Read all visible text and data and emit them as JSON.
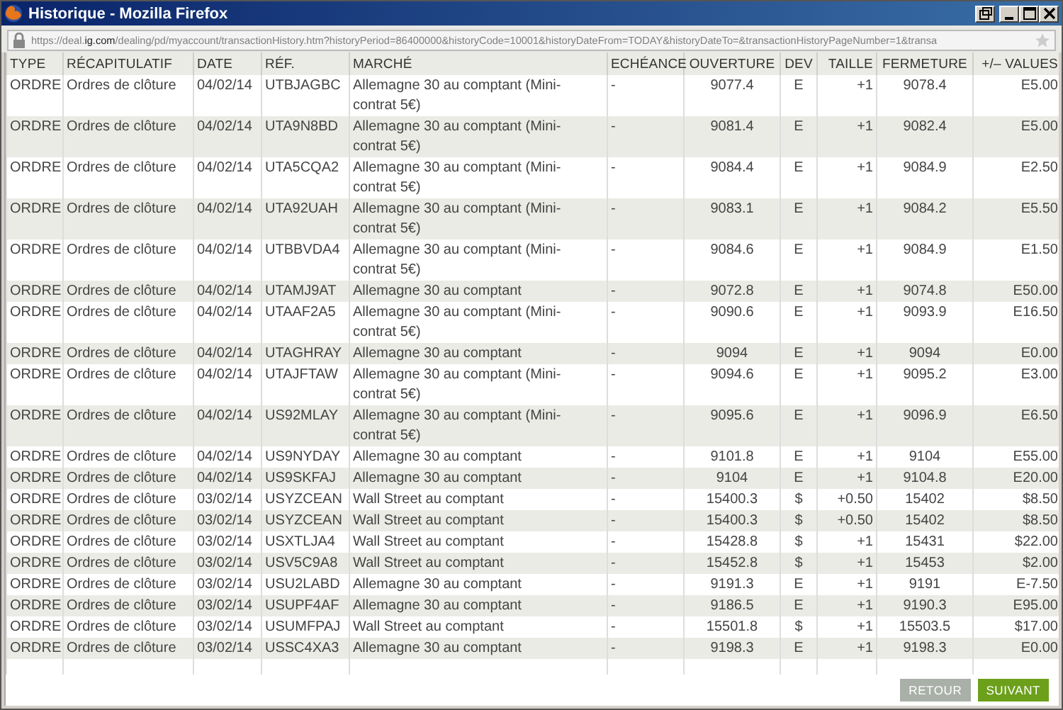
{
  "window": {
    "title": "Historique - Mozilla Firefox"
  },
  "address_bar": {
    "url_prefix": "https://deal.",
    "url_domain": "ig.com",
    "url_rest": "/dealing/pd/myaccount/transactionHistory.htm?historyPeriod=86400000&historyCode=10001&historyDateFrom=TODAY&historyDateTo=&transactionHistoryPageNumber=1&transa"
  },
  "table": {
    "columns": [
      "TYPE",
      "RÉCAPITULATIF",
      "DATE",
      "RÉF.",
      "MARCHÉ",
      "ECHÉANCE",
      "OUVERTURE",
      "DEV",
      "TAILLE",
      "FERMETURE",
      "+/– VALUES"
    ],
    "rows": [
      [
        "ORDRE",
        "Ordres de clôture",
        "04/02/14",
        "UTBJAGBC",
        "Allemagne 30 au comptant (Mini-contrat 5€)",
        "-",
        "9077.4",
        "E",
        "+1",
        "9078.4",
        "E5.00"
      ],
      [
        "ORDRE",
        "Ordres de clôture",
        "04/02/14",
        "UTA9N8BD",
        "Allemagne 30 au comptant (Mini-contrat 5€)",
        "-",
        "9081.4",
        "E",
        "+1",
        "9082.4",
        "E5.00"
      ],
      [
        "ORDRE",
        "Ordres de clôture",
        "04/02/14",
        "UTA5CQA2",
        "Allemagne 30 au comptant (Mini-contrat 5€)",
        "-",
        "9084.4",
        "E",
        "+1",
        "9084.9",
        "E2.50"
      ],
      [
        "ORDRE",
        "Ordres de clôture",
        "04/02/14",
        "UTA92UAH",
        "Allemagne 30 au comptant (Mini-contrat 5€)",
        "-",
        "9083.1",
        "E",
        "+1",
        "9084.2",
        "E5.50"
      ],
      [
        "ORDRE",
        "Ordres de clôture",
        "04/02/14",
        "UTBBVDA4",
        "Allemagne 30 au comptant (Mini-contrat 5€)",
        "-",
        "9084.6",
        "E",
        "+1",
        "9084.9",
        "E1.50"
      ],
      [
        "ORDRE",
        "Ordres de clôture",
        "04/02/14",
        "UTAMJ9AT",
        "Allemagne 30 au comptant",
        "-",
        "9072.8",
        "E",
        "+1",
        "9074.8",
        "E50.00"
      ],
      [
        "ORDRE",
        "Ordres de clôture",
        "04/02/14",
        "UTAAF2A5",
        "Allemagne 30 au comptant (Mini-contrat 5€)",
        "-",
        "9090.6",
        "E",
        "+1",
        "9093.9",
        "E16.50"
      ],
      [
        "ORDRE",
        "Ordres de clôture",
        "04/02/14",
        "UTAGHRAY",
        "Allemagne 30 au comptant",
        "-",
        "9094",
        "E",
        "+1",
        "9094",
        "E0.00"
      ],
      [
        "ORDRE",
        "Ordres de clôture",
        "04/02/14",
        "UTAJFTAW",
        "Allemagne 30 au comptant (Mini-contrat 5€)",
        "-",
        "9094.6",
        "E",
        "+1",
        "9095.2",
        "E3.00"
      ],
      [
        "ORDRE",
        "Ordres de clôture",
        "04/02/14",
        "US92MLAY",
        "Allemagne 30 au comptant (Mini-contrat 5€)",
        "-",
        "9095.6",
        "E",
        "+1",
        "9096.9",
        "E6.50"
      ],
      [
        "ORDRE",
        "Ordres de clôture",
        "04/02/14",
        "US9NYDAY",
        "Allemagne 30 au comptant",
        "-",
        "9101.8",
        "E",
        "+1",
        "9104",
        "E55.00"
      ],
      [
        "ORDRE",
        "Ordres de clôture",
        "04/02/14",
        "US9SKFAJ",
        "Allemagne 30 au comptant",
        "-",
        "9104",
        "E",
        "+1",
        "9104.8",
        "E20.00"
      ],
      [
        "ORDRE",
        "Ordres de clôture",
        "03/02/14",
        "USYZCEAN",
        "Wall Street au comptant",
        "-",
        "15400.3",
        "$",
        "+0.50",
        "15402",
        "$8.50"
      ],
      [
        "ORDRE",
        "Ordres de clôture",
        "03/02/14",
        "USYZCEAN",
        "Wall Street au comptant",
        "-",
        "15400.3",
        "$",
        "+0.50",
        "15402",
        "$8.50"
      ],
      [
        "ORDRE",
        "Ordres de clôture",
        "03/02/14",
        "USXTLJA4",
        "Wall Street au comptant",
        "-",
        "15428.8",
        "$",
        "+1",
        "15431",
        "$22.00"
      ],
      [
        "ORDRE",
        "Ordres de clôture",
        "03/02/14",
        "USV5C9A8",
        "Wall Street au comptant",
        "-",
        "15452.8",
        "$",
        "+1",
        "15453",
        "$2.00"
      ],
      [
        "ORDRE",
        "Ordres de clôture",
        "03/02/14",
        "USU2LABD",
        "Allemagne 30 au comptant",
        "-",
        "9191.3",
        "E",
        "+1",
        "9191",
        "E-7.50"
      ],
      [
        "ORDRE",
        "Ordres de clôture",
        "03/02/14",
        "USUPF4AF",
        "Allemagne 30 au comptant",
        "-",
        "9186.5",
        "E",
        "+1",
        "9190.3",
        "E95.00"
      ],
      [
        "ORDRE",
        "Ordres de clôture",
        "03/02/14",
        "USUMFPAJ",
        "Wall Street au comptant",
        "-",
        "15501.8",
        "$",
        "+1",
        "15503.5",
        "$17.00"
      ],
      [
        "ORDRE",
        "Ordres de clôture",
        "03/02/14",
        "USSC4XA3",
        "Allemagne 30 au comptant",
        "-",
        "9198.3",
        "E",
        "+1",
        "9198.3",
        "E0.00"
      ]
    ]
  },
  "buttons": [
    {
      "label": "RETOUR",
      "disabled": true
    },
    {
      "label": "SUIVANT",
      "disabled": false
    }
  ]
}
